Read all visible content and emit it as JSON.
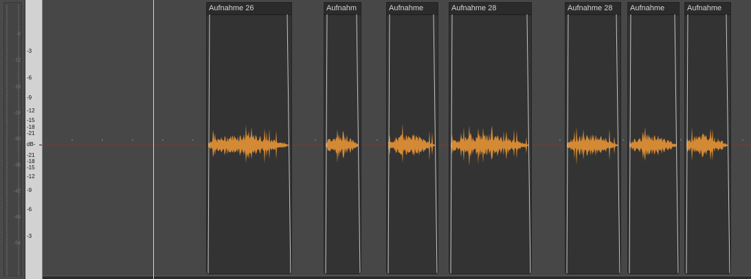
{
  "meter": {
    "labels": [
      "-6",
      "-12",
      "-18",
      "-24",
      "-30",
      "-36",
      "-42",
      "-48",
      "-54"
    ]
  },
  "scale": {
    "unit": "dB-",
    "labels_top": [
      "-3",
      "-6",
      "-9",
      "-12",
      "-15",
      "-18",
      "-21"
    ],
    "labels_bottom": [
      "-21",
      "-18",
      "-15",
      "-12",
      "-9",
      "-6",
      "-3"
    ]
  },
  "colors": {
    "waveform": "#d48a35",
    "zero_line": "#7a3a30",
    "fade_line": "#c8c8c8"
  },
  "clips": [
    {
      "title": "Aufnahme 26"
    },
    {
      "title": "Aufnahm"
    },
    {
      "title": "Aufnahme"
    },
    {
      "title": "Aufnahme 28"
    },
    {
      "title": "Aufnahme 28"
    },
    {
      "title": "Aufnahme"
    },
    {
      "title": "Aufnahme"
    }
  ]
}
